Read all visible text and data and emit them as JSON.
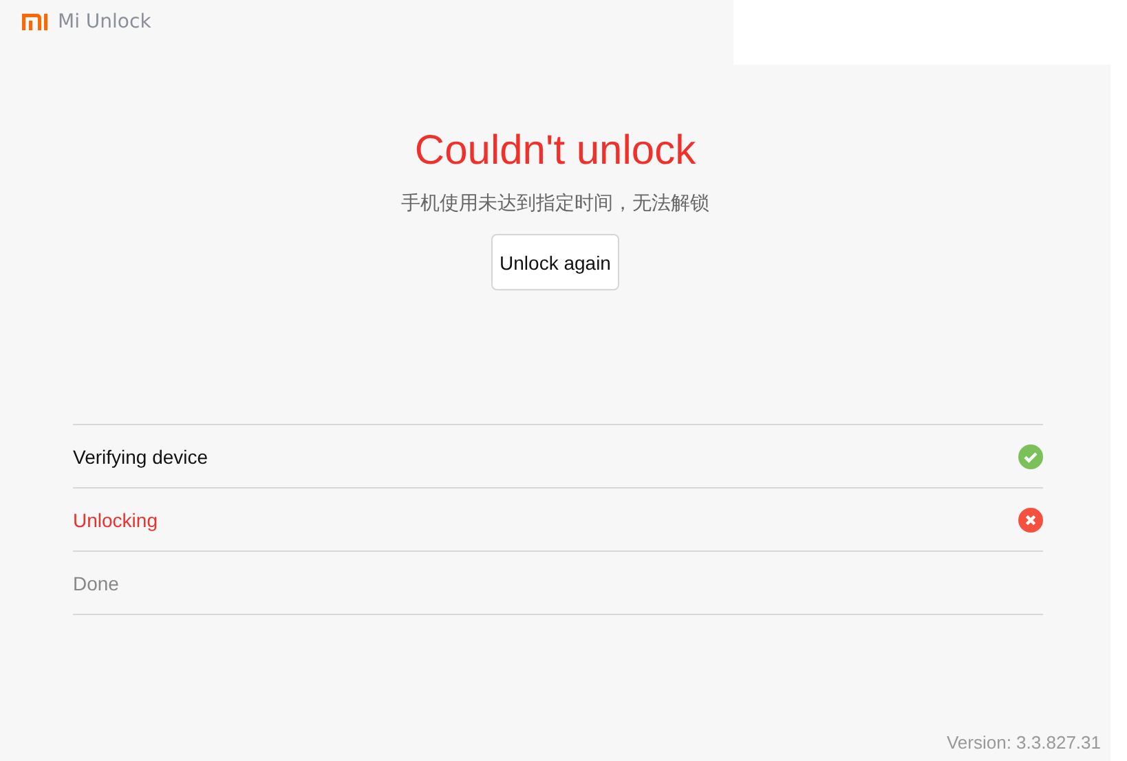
{
  "app": {
    "title": "Mi Unlock"
  },
  "result": {
    "title": "Couldn't unlock",
    "message": "手机使用未达到指定时间，无法解锁",
    "button": "Unlock again"
  },
  "steps": [
    {
      "label": "Verifying device",
      "kind": "done"
    },
    {
      "label": "Unlocking",
      "kind": "failed"
    },
    {
      "label": "Done",
      "kind": "pending"
    }
  ],
  "version": "Version: 3.3.827.31"
}
